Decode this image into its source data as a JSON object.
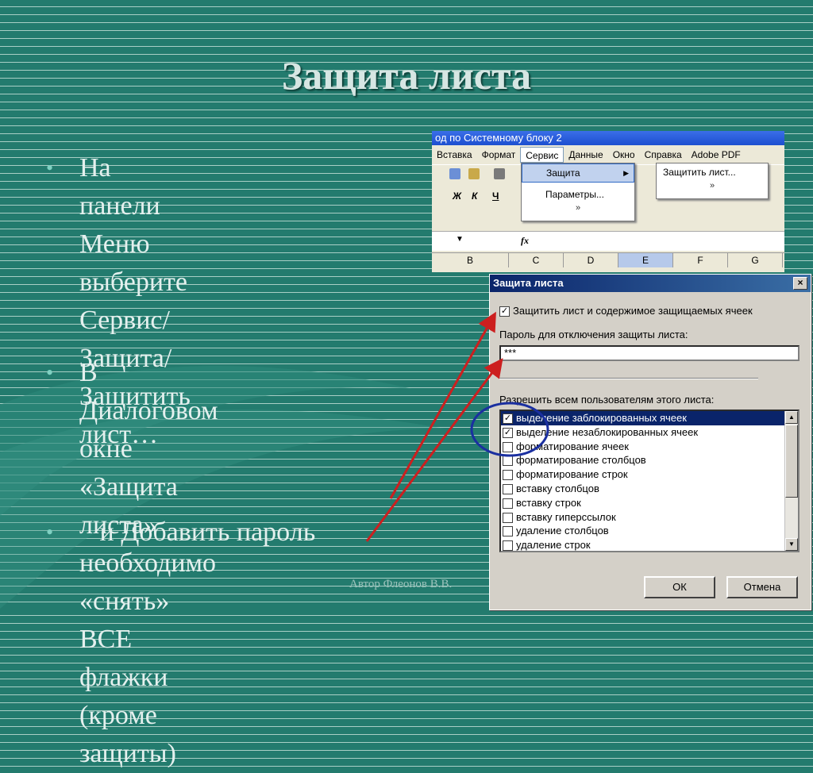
{
  "slide": {
    "title": "Защита листа",
    "bullets": [
      "На панели Меню\nвыберите\nСервис/Защита/\nЗащитить лист…",
      "В Диалоговом окне\n«Защита листа»\nнеобходимо «снять» ВСЕ\nфлажки (кроме защиты)",
      "   и Добавить пароль"
    ],
    "bullet_glyph": "•",
    "footer": "Автор Флеонов В.В."
  },
  "excel": {
    "window_title": "од по Системному блоку 2",
    "menu": [
      "Вставка",
      "Формат",
      "Сервис",
      "Данные",
      "Окно",
      "Справка",
      "Adobe PDF"
    ],
    "active_menu": "Сервис",
    "dropdown": [
      "Защита",
      "Параметры..."
    ],
    "submenu": [
      "Защитить лист..."
    ],
    "expand": "»",
    "format_buttons": [
      "Ж",
      "К",
      "Ч"
    ],
    "fx": "fx",
    "columns": [
      "B",
      "C",
      "D",
      "E",
      "F",
      "G"
    ],
    "selected_column": "E"
  },
  "dialog": {
    "title": "Защита листа",
    "close": "×",
    "protect_label": "Защитить лист и содержимое защищаемых ячеек",
    "protect_checked": true,
    "password_label": "Пароль для отключения защиты листа:",
    "password_value": "***",
    "allow_label": "Разрешить всем пользователям этого листа:",
    "permissions": [
      {
        "label": "выделение заблокированных ячеек",
        "checked": true
      },
      {
        "label": "выделение незаблокированных ячеек",
        "checked": true
      },
      {
        "label": "форматирование ячеек",
        "checked": false
      },
      {
        "label": "форматирование столбцов",
        "checked": false
      },
      {
        "label": "форматирование строк",
        "checked": false
      },
      {
        "label": "вставку столбцов",
        "checked": false
      },
      {
        "label": "вставку строк",
        "checked": false
      },
      {
        "label": "вставку гиперссылок",
        "checked": false
      },
      {
        "label": "удаление столбцов",
        "checked": false
      },
      {
        "label": "удаление строк",
        "checked": false
      }
    ],
    "ok": "ОК",
    "cancel": "Отмена"
  },
  "colors": {
    "annotation_red": "#cc1f1f",
    "annotation_circle": "#1a2fa0",
    "selection_navy": "#0a246a"
  }
}
